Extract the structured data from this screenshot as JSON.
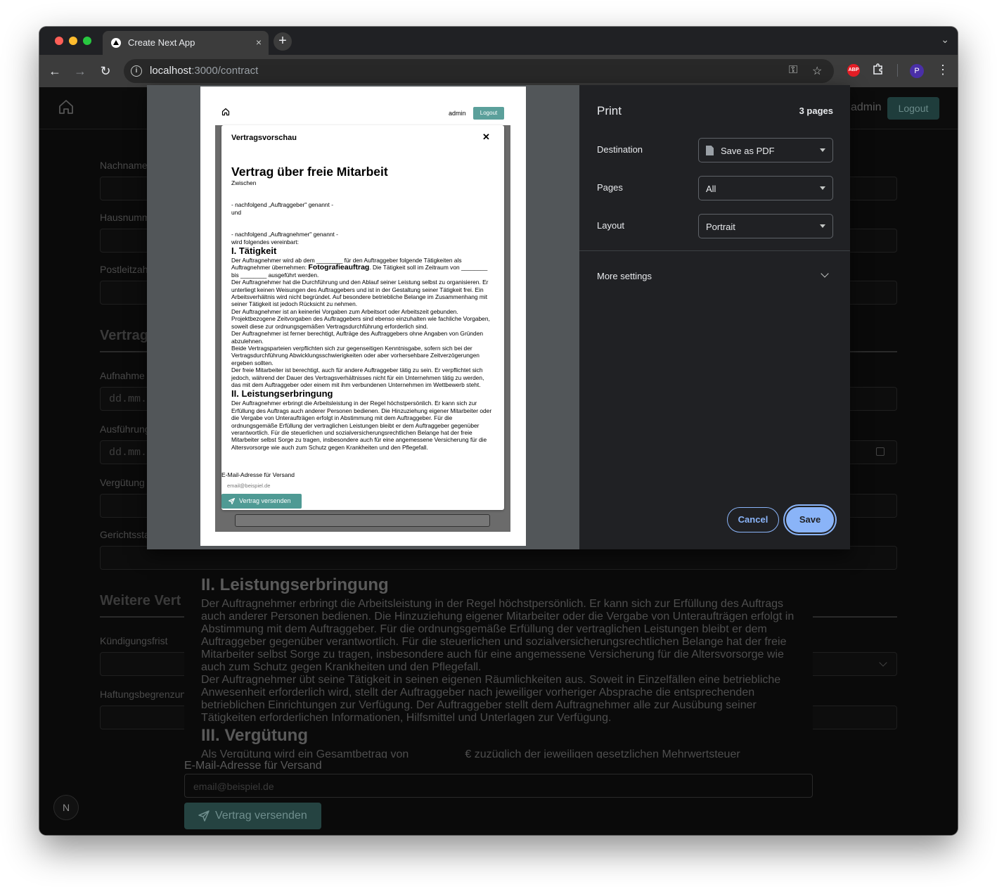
{
  "browser": {
    "tab_title": "Create Next App",
    "tab_close": "×",
    "new_tab": "+",
    "url_host": "localhost",
    "url_path": ":3000/contract",
    "profile_initial": "P",
    "abp_label": "ABP"
  },
  "page": {
    "nav": {
      "admin": "admin",
      "logout": "Logout"
    },
    "fields": {
      "nachname": "Nachname",
      "hausnummer": "Hausnumm",
      "postleitzahl": "Postleitzah",
      "vertrag_section": "Vertrag",
      "aufnahme": "Aufnahme",
      "aufnahme_placeholder": "dd.mm.",
      "ausfuehrung": "Ausführung",
      "ausfuehrung_placeholder": "dd.mm.",
      "verguetung": "Vergütung",
      "gerichtsstand": "Gerichtssta",
      "weitere_section": "Weitere Vert",
      "kuendigungsfrist": "Kündigungsfrist",
      "haftungsbegrenzung": "Haftungsbegrenzun"
    },
    "background_doc": {
      "h_leistung": "II. Leistungserbringung",
      "p_leistung_1": "Der Auftragnehmer erbringt die Arbeitsleistung in der Regel höchstpersönlich. Er kann sich zur Erfüllung des Auftrags auch anderer Personen bedienen. Die Hinzuziehung eigener Mitarbeiter oder die Vergabe von Unteraufträgen erfolgt in Abstimmung mit dem Auftraggeber. Für die ordnungsgemäße Erfüllung der vertraglichen Leistungen bleibt er dem Auftraggeber gegenüber verantwortlich. Für die steuerlichen und sozialversicherungsrechtlichen Belange hat der freie Mitarbeiter selbst Sorge zu tragen, insbesondere auch für eine angemessene Versicherung für die Altersvorsorge wie auch zum Schutz gegen Krankheiten und den Pflegefall.",
      "p_leistung_2": "Der Auftragnehmer übt seine Tätigkeit in seinen eigenen Räumlichkeiten aus. Soweit in Einzelfällen eine betriebliche Anwesenheit erforderlich wird, stellt der Auftraggeber nach jeweiliger vorheriger Absprache die entsprechenden betrieblichen Einrichtungen zur Verfügung. Der Auftraggeber stellt dem Auftragnehmer alle zur Ausübung seiner Tätigkeiten erforderlichen Informationen, Hilfsmittel und Unterlagen zur Verfügung.",
      "h_verguetung": "III. Vergütung",
      "p_verguetung": "Als Vergütung wird ein Gesamtbetrag von ________ € zuzüglich der jeweiligen gesetzlichen Mehrwertsteuer",
      "email_label": "E-Mail-Adresse für Versand",
      "email_placeholder": "email@beispiel.de",
      "send_button": "Vertrag versenden"
    },
    "nextjs_badge": "N"
  },
  "print_dialog": {
    "title": "Print",
    "page_count": "3 pages",
    "destination_label": "Destination",
    "destination_value": "Save as PDF",
    "pages_label": "Pages",
    "pages_value": "All",
    "layout_label": "Layout",
    "layout_value": "Portrait",
    "more_settings": "More settings",
    "cancel": "Cancel",
    "save": "Save"
  },
  "preview": {
    "admin": "admin",
    "logout": "Logout",
    "modal_title": "Vertragsvorschau",
    "close": "✕",
    "doc_title": "Vertrag über freie Mitarbeit",
    "zwischen": "Zwischen",
    "auftraggeber": "- nachfolgend „Auftraggeber\" genannt -",
    "und": "und",
    "auftragnehmer": "- nachfolgend „Auftragnehmer\" genannt -",
    "vereinbart": "wird folgendes vereinbart:",
    "h_taetigkeit": "I. Tätigkeit",
    "t1_a": "Der Auftragnehmer wird ab dem ________ für den Auftraggeber folgende Tätigkeiten als Auftragnehmer übernehmen: ",
    "t1_bold": "Fotografieauftrag",
    "t1_b": ". Die Tätigkeit soll im Zeitraum von ________ bis ________ ausgeführt werden.",
    "t2": "Der Auftragnehmer hat die Durchführung und den Ablauf seiner Leistung selbst zu organisieren. Er unterliegt keinen Weisungen des Auftraggebers und ist in der Gestaltung seiner Tätigkeit frei. Ein Arbeitsverhältnis wird nicht begründet. Auf besondere betriebliche Belange im Zusammenhang mit seiner Tätigkeit ist jedoch Rücksicht zu nehmen.",
    "t3": "Der Auftragnehmer ist an keinerlei Vorgaben zum Arbeitsort oder Arbeitszeit gebunden. Projektbezogene Zeitvorgaben des Auftraggebers sind ebenso einzuhalten wie fachliche Vorgaben, soweit diese zur ordnungsgemäßen Vertragsdurchführung erforderlich sind.",
    "t4": "Der Auftragnehmer ist ferner berechtigt, Aufträge des Auftraggebers ohne Angaben von Gründen abzulehnen.",
    "t5": "Beide Vertragsparteien verpflichten sich zur gegenseitigen Kenntnisgabe, sofern sich bei der Vertragsdurchführung Abwicklungsschwierigkeiten oder aber vorhersehbare Zeitverzögerungen ergeben sollten.",
    "t6": "Der freie Mitarbeiter ist berechtigt, auch für andere Auftraggeber tätig zu sein. Er verpflichtet sich jedoch, während der Dauer des Vertragsverhältnisses nicht für ein Unternehmen tätig zu werden, das mit dem Auftraggeber oder einem mit ihm verbundenen Unternehmen im Wettbewerb steht.",
    "h_leistung": "II. Leistungserbringung",
    "l1": "Der Auftragnehmer erbringt die Arbeitsleistung in der Regel höchstpersönlich. Er kann sich zur Erfüllung des Auftrags auch anderer Personen bedienen. Die Hinzuziehung eigener Mitarbeiter oder die Vergabe von Unteraufträgen erfolgt in Abstimmung mit dem Auftraggeber. Für die ordnungsgemäße Erfüllung der vertraglichen Leistungen bleibt er dem Auftraggeber gegenüber verantwortlich. Für die steuerlichen und sozialversicherungsrechtlichen Belange hat der freie Mitarbeiter selbst Sorge zu tragen, insbesondere auch für eine angemessene Versicherung für die Altersvorsorge wie auch zum Schutz gegen Krankheiten und den Pflegefall.",
    "email_label": "E-Mail-Adresse für Versand",
    "email_placeholder": "email@beispiel.de",
    "send_button": "Vertrag versenden"
  }
}
